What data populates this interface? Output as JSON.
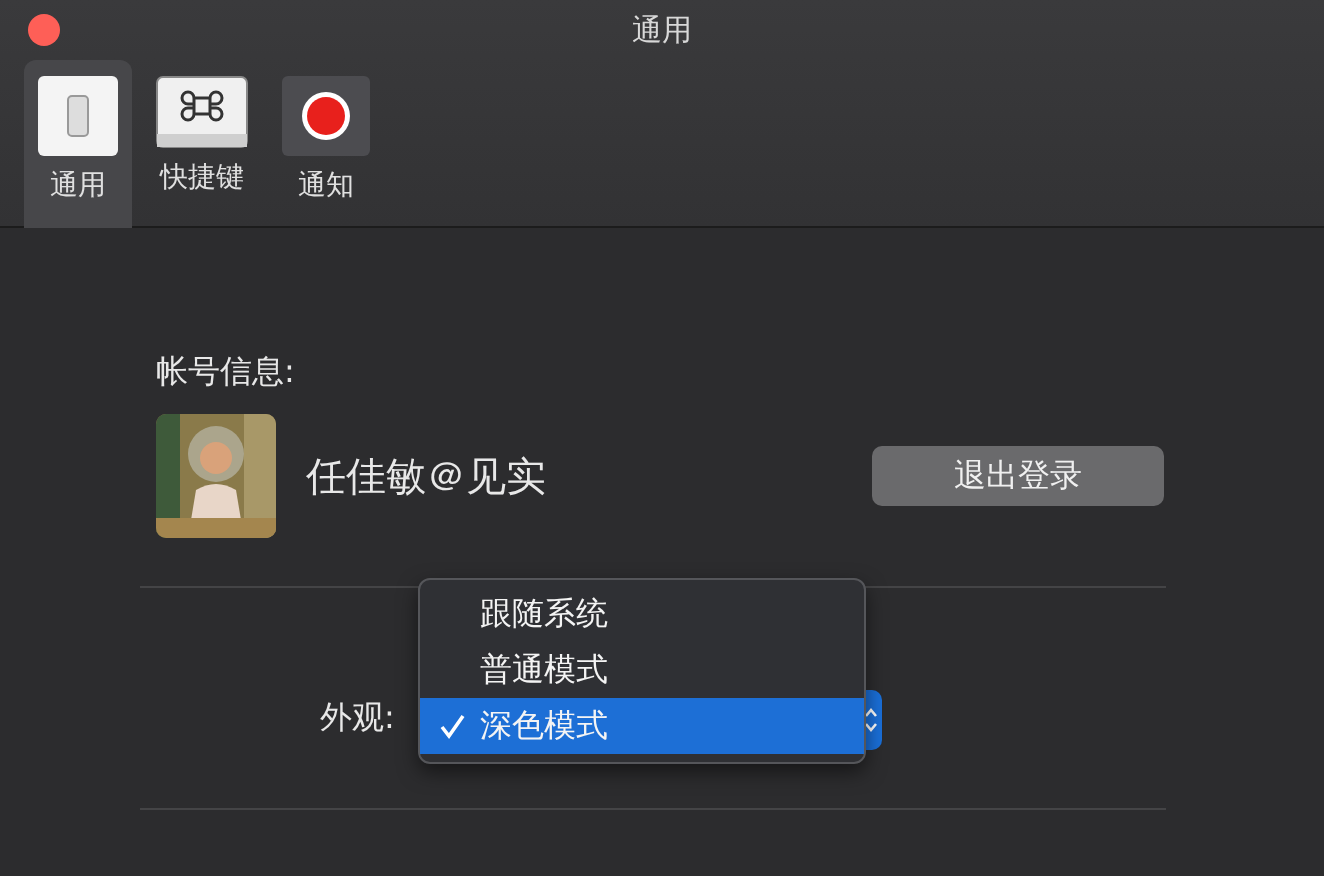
{
  "window": {
    "title": "通用"
  },
  "tabs": [
    {
      "label": "通用",
      "kind": "switch",
      "selected": true
    },
    {
      "label": "快捷键",
      "kind": "keyboard",
      "selected": false
    },
    {
      "label": "通知",
      "kind": "record",
      "selected": false
    }
  ],
  "account": {
    "heading": "帐号信息:",
    "name": "任佳敏＠见实",
    "logout_button": "退出登录"
  },
  "appearance": {
    "label": "外观:",
    "menu": [
      {
        "label": "跟随系统",
        "selected": false
      },
      {
        "label": "普通模式",
        "selected": false
      },
      {
        "label": "深色模式",
        "selected": true
      }
    ]
  }
}
